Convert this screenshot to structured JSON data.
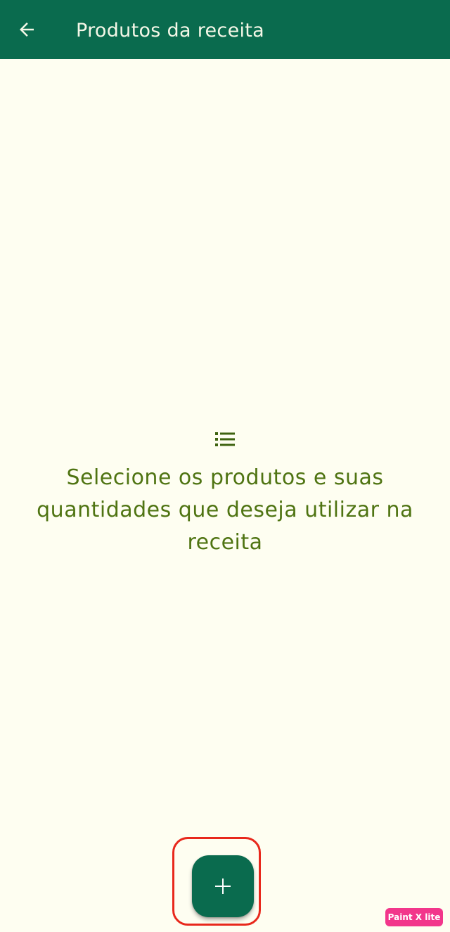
{
  "app_bar": {
    "title": "Produtos da receita",
    "back_icon": "arrow-back-icon"
  },
  "empty_state": {
    "icon": "list-icon",
    "message": "Selecione os produtos e suas quantidades que deseja utilizar na receita"
  },
  "fab": {
    "icon": "plus-icon"
  },
  "watermark": {
    "text": "Paint X lite"
  },
  "colors": {
    "primary": "#0A6B4E",
    "background": "#FEFEF1",
    "message_text": "#4F7412",
    "highlight": "#E8281C",
    "watermark": "#F2368B"
  }
}
